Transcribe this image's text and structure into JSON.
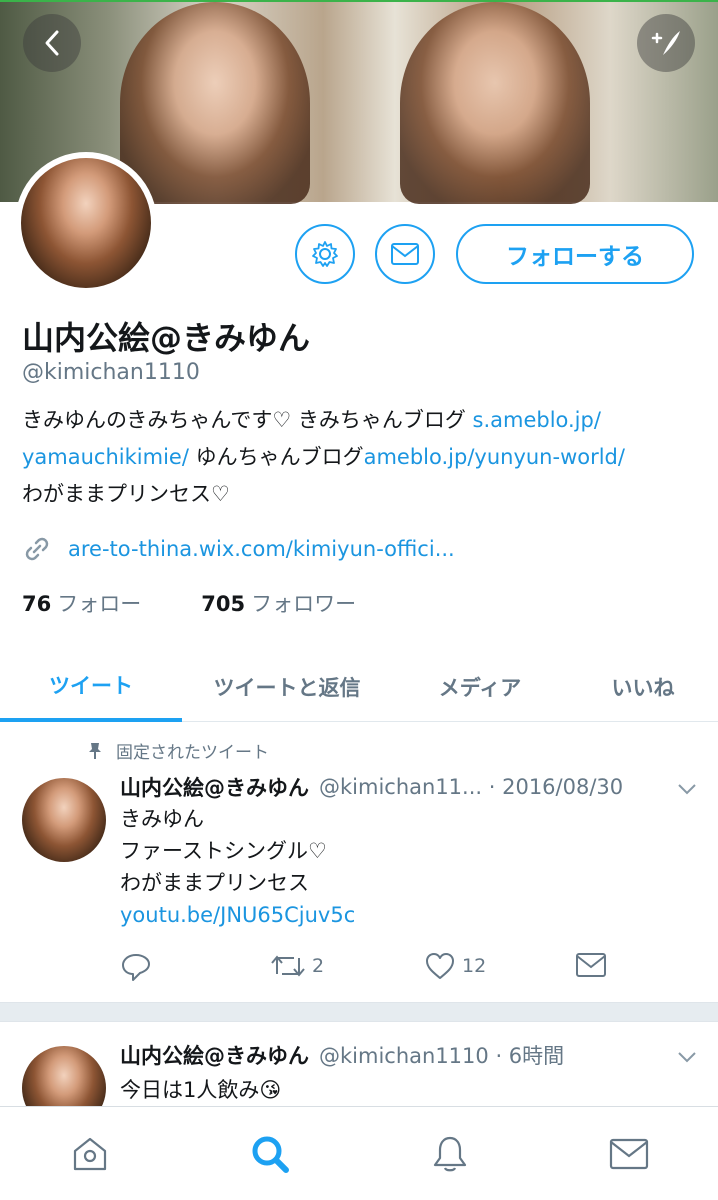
{
  "profile": {
    "name": "山内公絵@きみゆん",
    "handle": "@kimichan1110",
    "bio_part1": "きみゆんのきみちゃんです♡ きみちゃんブログ ",
    "bio_link1a": "s.ameblo.jp/",
    "bio_link1b": "yamauchikimie/",
    "bio_part2": " ゆんちゃんブログ",
    "bio_link2": "ameblo.jp/yunyun-world/",
    "bio_part3": "わがままプリンセス♡",
    "url": "are-to-thina.wix.com/kimiyun-offici...",
    "following_count": "76",
    "following_label": "フォロー",
    "followers_count": "705",
    "followers_label": "フォロワー",
    "follow_button": "フォローする"
  },
  "tabs": [
    {
      "label": "ツイート",
      "active": true
    },
    {
      "label": "ツイートと返信",
      "active": false
    },
    {
      "label": "メディア",
      "active": false
    },
    {
      "label": "いいね",
      "active": false
    }
  ],
  "tweets": [
    {
      "pinned_label": "固定されたツイート",
      "name": "山内公絵@きみゆん",
      "handle_time": "@kimichan11... · 2016/08/30",
      "line1": "きみゆん",
      "line2": "ファーストシングル♡",
      "line3": "わがままプリンセス",
      "link": "youtu.be/JNU65Cjuv5c",
      "retweets": "2",
      "likes": "12"
    },
    {
      "name": "山内公絵@きみゆん",
      "handle_time": "@kimichan1110 · 6時間",
      "line1": "今日は1人飲み😘"
    }
  ],
  "icons": {
    "back": "back-arrow-icon",
    "compose": "compose-icon",
    "gear": "gear-icon",
    "mail": "mail-icon",
    "link": "link-icon",
    "pin": "pin-icon",
    "reply": "reply-icon",
    "retweet": "retweet-icon",
    "like": "heart-icon",
    "dm": "mail-icon",
    "home": "home-icon",
    "search": "search-icon",
    "notifications": "bell-icon",
    "messages": "mail-icon"
  },
  "colors": {
    "accent": "#1da1f2",
    "link": "#1b95e0",
    "muted": "#657786"
  }
}
